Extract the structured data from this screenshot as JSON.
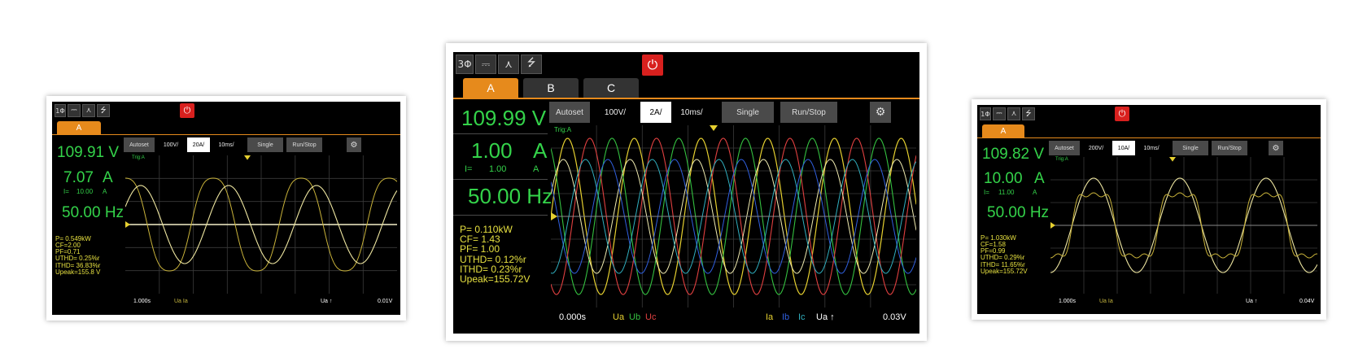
{
  "common": {
    "power_label": "ON",
    "gear_icon": "⚙"
  },
  "left": {
    "phase_icon": "1Φ",
    "tabs": [
      "A"
    ],
    "controls": {
      "autoset": "Autoset",
      "volts_div": "100V/",
      "amps_div": "20A/",
      "time_div": "10ms/",
      "single": "Single",
      "runstop": "Run/Stop"
    },
    "voltage": "109.91 V",
    "current": "7.07",
    "current_unit": "A",
    "i_peak_label": "I=",
    "i_peak": "10.00",
    "i_peak_unit": "A",
    "frequency": "50.00 Hz",
    "stats": [
      "P=  0.549kW",
      "CF=2.00",
      "PF=0.71",
      "UTHD= 0.25%r",
      "ITHD= 36.83%r",
      "Upeak=155.8 V"
    ],
    "plot_label": "Trig:A",
    "footer_time": "1.000s",
    "footer_legend": "Ua  Ia",
    "footer_right_label": "Ua ↑",
    "footer_right_val": "0.01V"
  },
  "center": {
    "phase_icon": "3Φ",
    "tabs": [
      "A",
      "B",
      "C"
    ],
    "controls": {
      "autoset": "Autoset",
      "volts_div": "100V/",
      "amps_div": "2A/",
      "time_div": "10ms/",
      "single": "Single",
      "runstop": "Run/Stop"
    },
    "voltage": "109.99 V",
    "current": "1.00",
    "current_unit": "A",
    "i_peak_label": "I=",
    "i_peak": "1.00",
    "i_peak_unit": "A",
    "frequency": "50.00 Hz",
    "stats": [
      "P=  0.110kW",
      "CF= 1.43",
      "PF= 1.00",
      "UTHD=  0.12%r",
      "ITHD=  0.23%r",
      "Upeak=155.72V"
    ],
    "plot_label": "Trig:A",
    "footer_time": "0.000s",
    "footer_legend": [
      "Ua",
      "Ub",
      "Uc"
    ],
    "footer_legend2": [
      "Ia",
      "Ib",
      "Ic"
    ],
    "footer_right_label": "Ua ↑",
    "footer_right_val": "0.03V"
  },
  "right": {
    "phase_icon": "1Φ",
    "tabs": [
      "A"
    ],
    "controls": {
      "autoset": "Autoset",
      "volts_div": "200V/",
      "amps_div": "10A/",
      "time_div": "10ms/",
      "single": "Single",
      "runstop": "Run/Stop"
    },
    "voltage": "109.82 V",
    "current": "10.00",
    "current_unit": "A",
    "i_peak_label": "I=",
    "i_peak": "11.00",
    "i_peak_unit": "A",
    "frequency": "50.00 Hz",
    "stats": [
      "P=  1.030kW",
      "CF=1.58",
      "PF=0.99",
      "UTHD=  0.29%r",
      "ITHD= 11.65%r",
      "Upeak=155.72V"
    ],
    "plot_label": "Trig:A",
    "footer_time": "1.000s",
    "footer_legend": "Ua  Ia",
    "footer_right_label": "Ua ↑",
    "footer_right_val": "0.04V"
  }
}
